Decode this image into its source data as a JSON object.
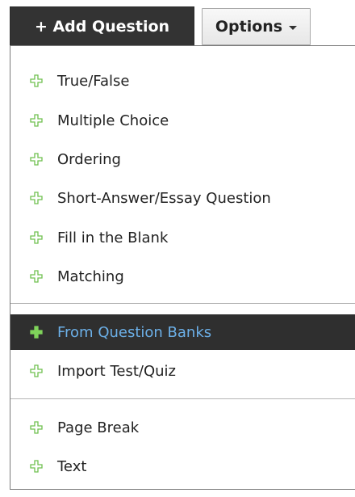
{
  "toolbar": {
    "add_question_label": "+ Add Question",
    "options_label": "Options"
  },
  "menu": {
    "groups": [
      {
        "items": [
          {
            "label": "True/False"
          },
          {
            "label": "Multiple Choice"
          },
          {
            "label": "Ordering"
          },
          {
            "label": "Short-Answer/Essay Question"
          },
          {
            "label": "Fill in the Blank"
          },
          {
            "label": "Matching"
          }
        ]
      },
      {
        "items": [
          {
            "label": "From Question Banks",
            "active": true
          },
          {
            "label": "Import Test/Quiz"
          }
        ]
      },
      {
        "items": [
          {
            "label": "Page Break"
          },
          {
            "label": "Text"
          }
        ]
      }
    ]
  },
  "colors": {
    "add_button_bg": "#333333",
    "active_item_bg": "#2f2f2f",
    "active_item_text": "#6cb0e8",
    "plus_icon": "#6fc04f",
    "plus_icon_active": "#7fd35a"
  },
  "icons": {
    "item_icon": "plus-outline-icon",
    "options_caret": "caret-down-icon"
  }
}
